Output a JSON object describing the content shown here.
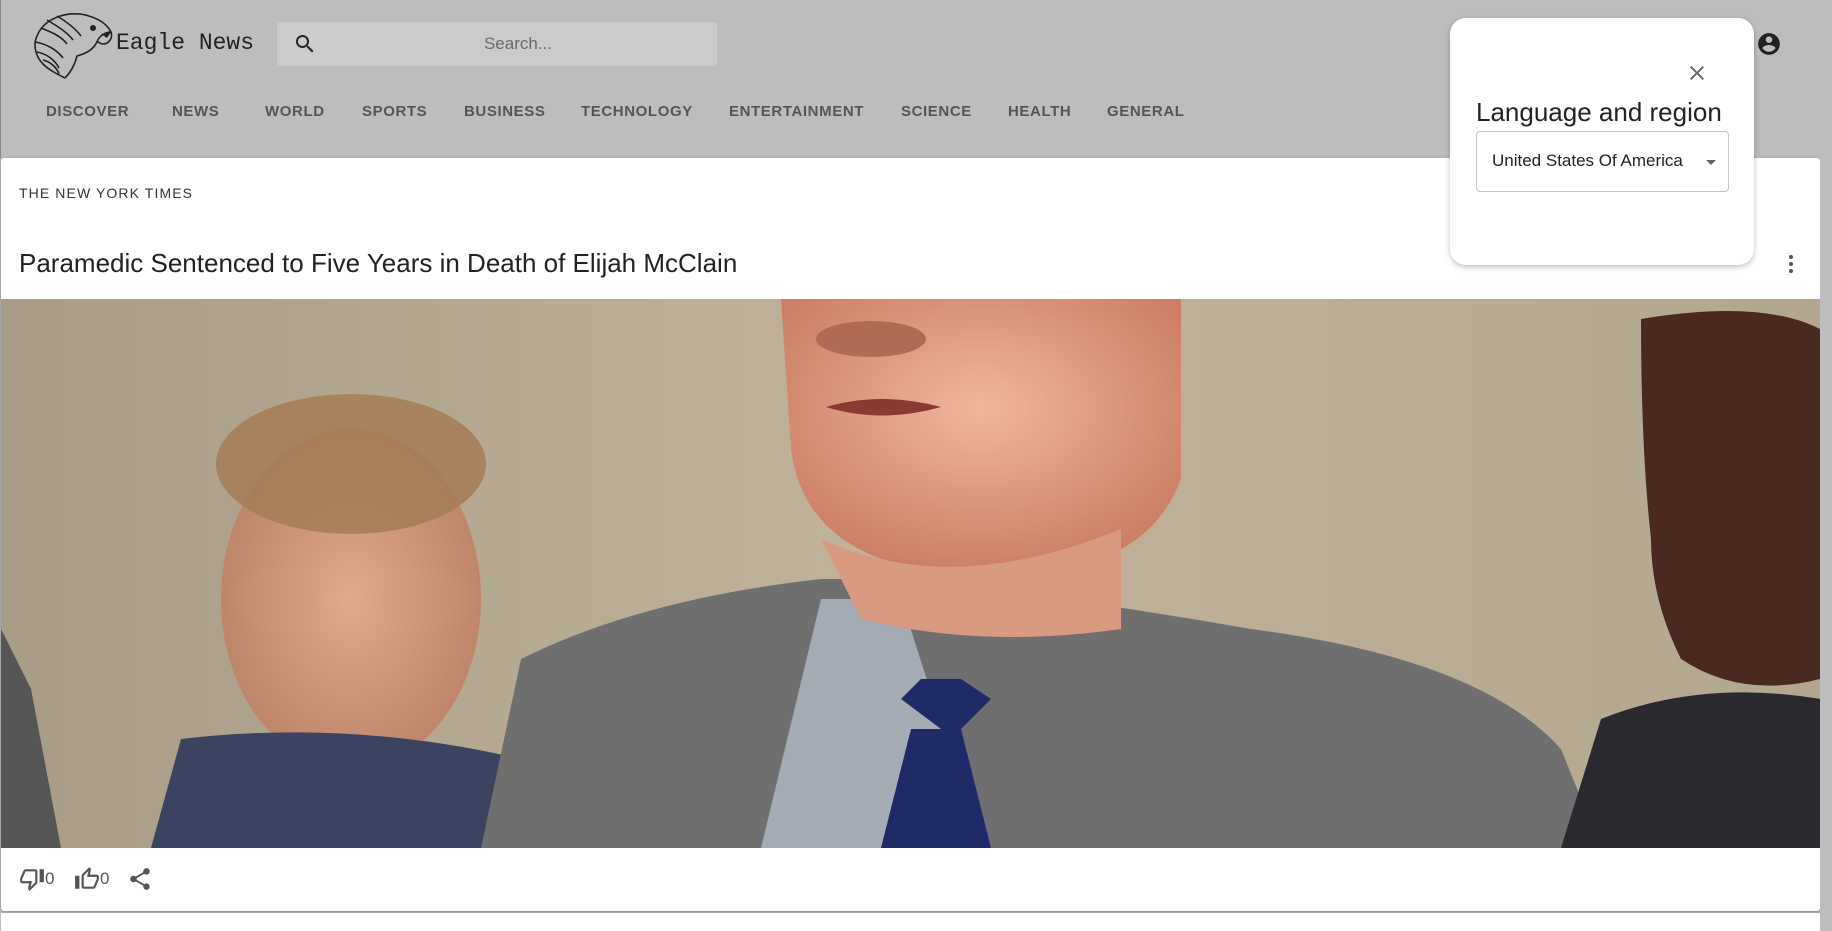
{
  "header": {
    "brand": "Eagle News",
    "search_placeholder": "Search...",
    "nav": [
      {
        "label": "DISCOVER"
      },
      {
        "label": "NEWS"
      },
      {
        "label": "WORLD"
      },
      {
        "label": "SPORTS"
      },
      {
        "label": "BUSINESS"
      },
      {
        "label": "TECHNOLOGY"
      },
      {
        "label": "ENTERTAINMENT"
      },
      {
        "label": "SCIENCE"
      },
      {
        "label": "HEALTH"
      },
      {
        "label": "GENERAL"
      }
    ]
  },
  "article": {
    "source": "THE NEW YORK TIMES",
    "headline": "Paramedic Sentenced to Five Years in Death of Elijah McClain",
    "dislike_count": "0",
    "like_count": "0"
  },
  "popup": {
    "title": "Language and region",
    "selected_region": "United States Of America"
  },
  "colors": {
    "header_bg": "#bdbdbd",
    "card_bg": "#ffffff",
    "nav_text": "#555555"
  }
}
